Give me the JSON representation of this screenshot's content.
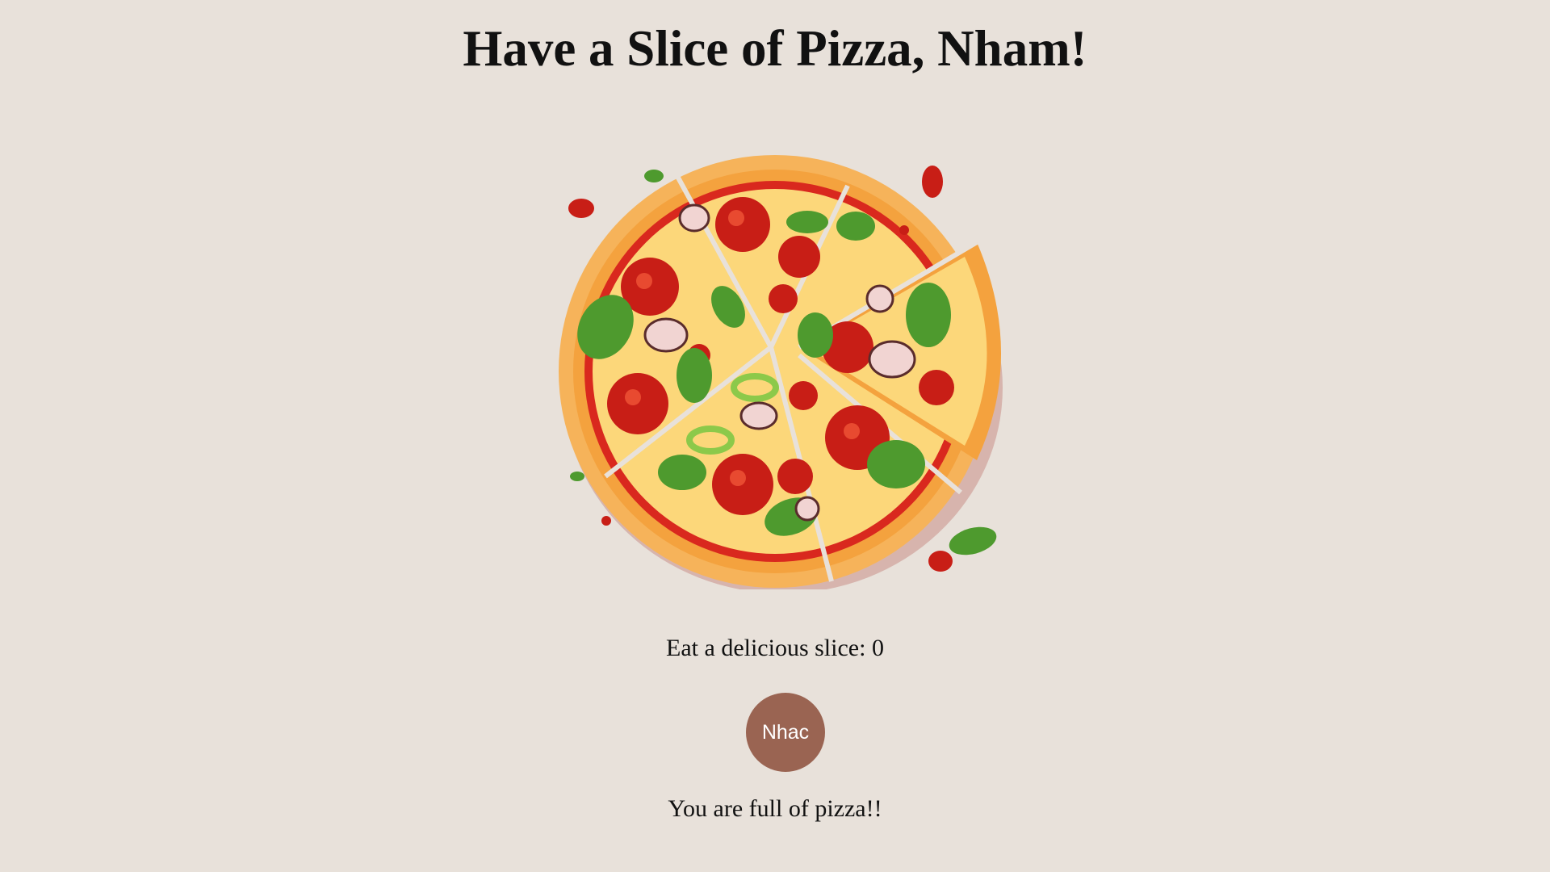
{
  "header": {
    "title": "Have a Slice of Pizza, Nham!"
  },
  "pizza_image": {
    "icon": "pizza-illustration"
  },
  "counter": {
    "text": "Eat a delicious slice: 0"
  },
  "music_button": {
    "label": "Nhac"
  },
  "status": {
    "text": "You are full of pizza!!"
  },
  "colors": {
    "background": "#e8e1da",
    "button": "#9a6452",
    "crust": "#f2a548",
    "sauce": "#d9281e",
    "cheese": "#fcd77a",
    "pepperoni": "#c81e16",
    "basil": "#4e9a2e"
  }
}
